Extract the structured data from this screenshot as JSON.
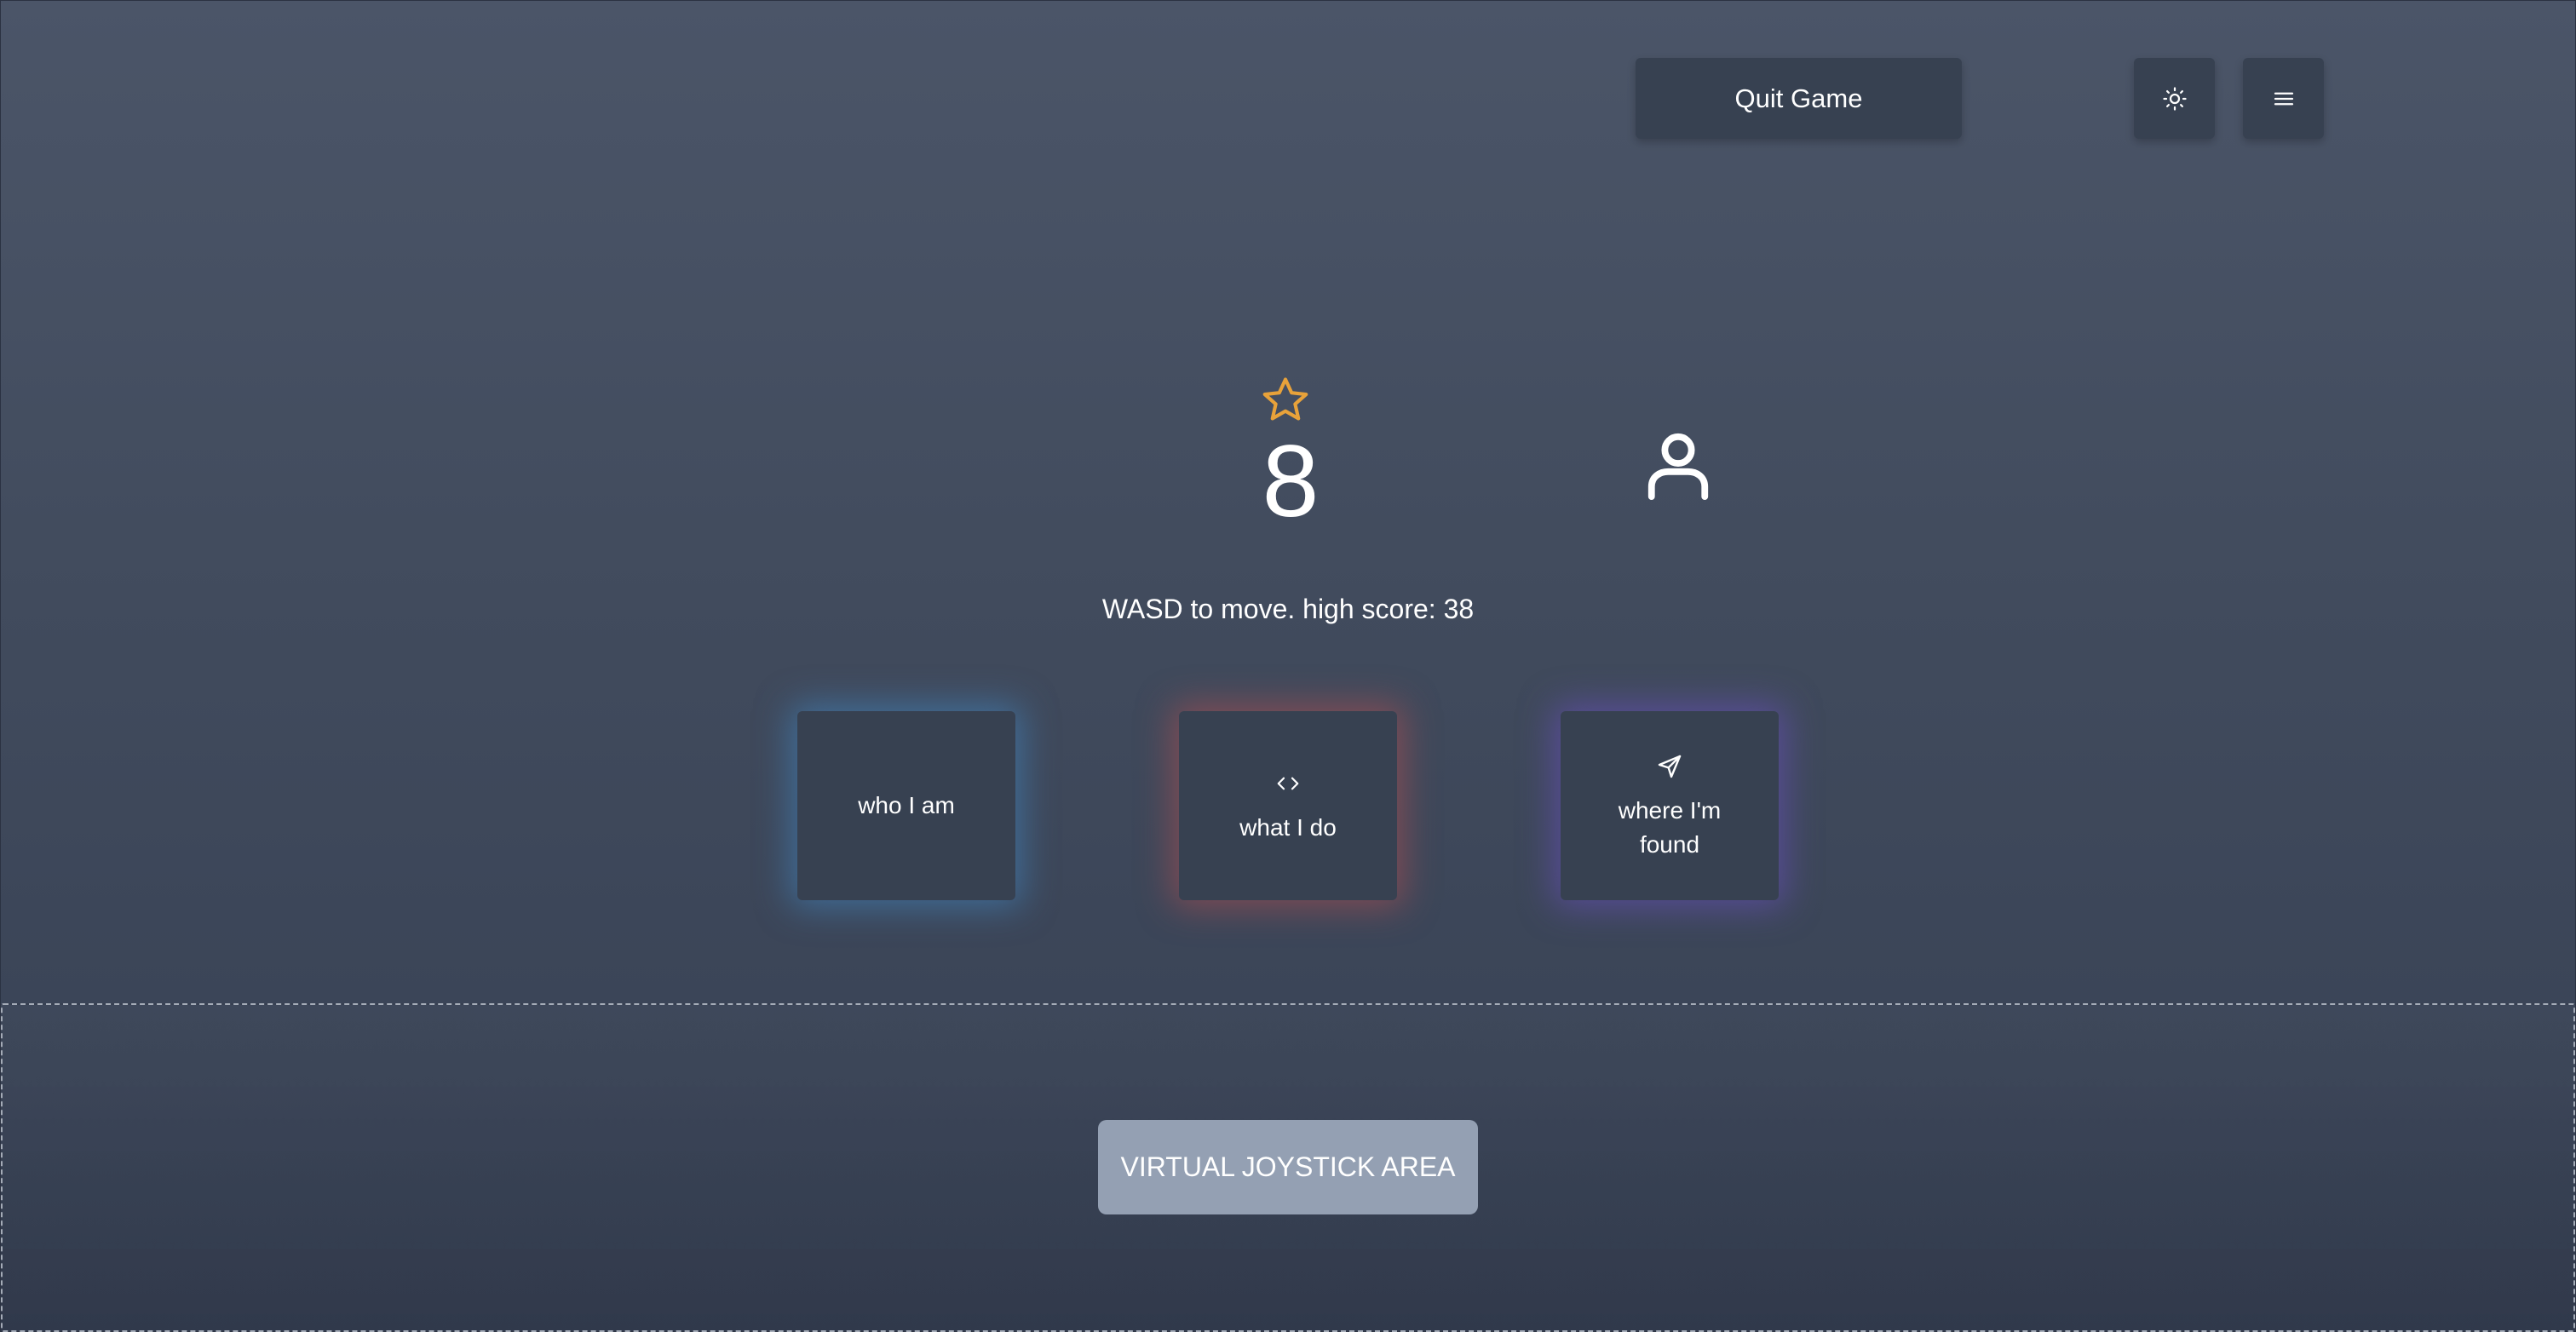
{
  "header": {
    "quit_label": "Quit Game",
    "theme_icon": "sun-icon",
    "menu_icon": "hamburger-menu-icon"
  },
  "hud": {
    "score_icon": "star-icon",
    "score": "8",
    "player_icon": "user-icon",
    "hint": "WASD to move. high score: 38"
  },
  "cards": [
    {
      "label": "who I am",
      "icon": "",
      "glow": "#428ac9"
    },
    {
      "label": "what I do",
      "icon": "code-icon",
      "glow": "#c45050"
    },
    {
      "label": "where I'm found",
      "icon": "send-icon",
      "glow": "#6e50c8"
    }
  ],
  "joystick": {
    "label": "VIRTUAL JOYSTICK AREA"
  },
  "colors": {
    "accent_star": "#e8a23a",
    "button_bg": "#374151",
    "joystick_bg": "#94a0b3"
  }
}
